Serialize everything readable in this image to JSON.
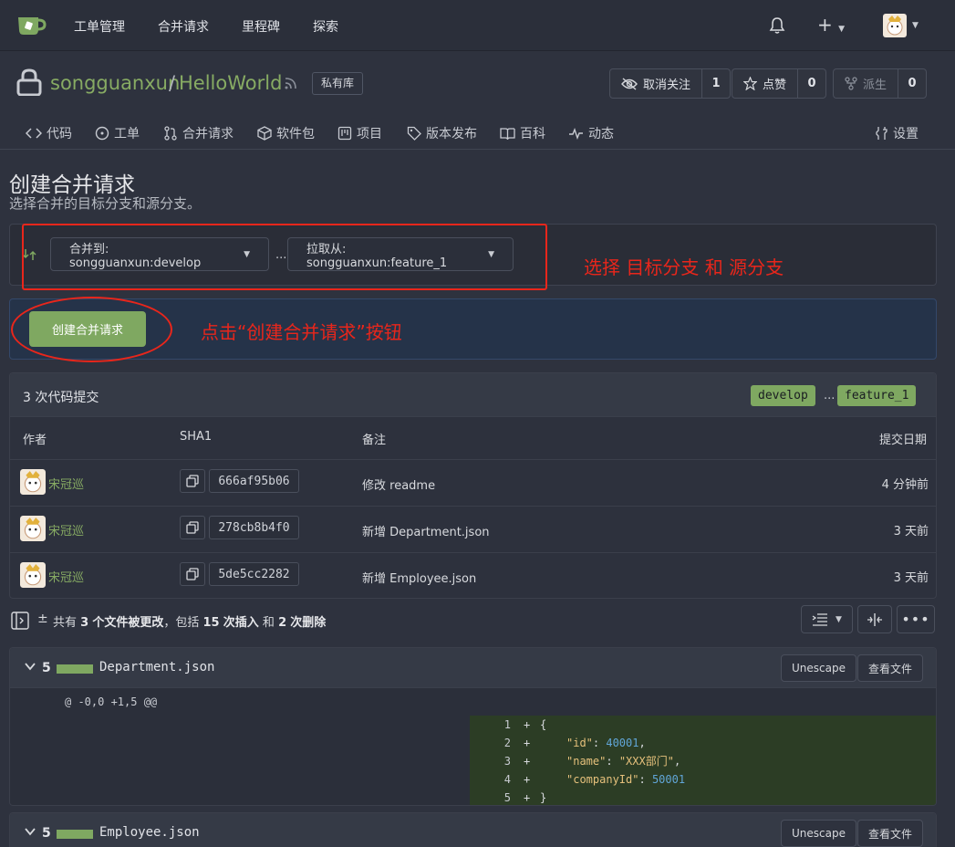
{
  "nav": {
    "items": [
      "工单管理",
      "合并请求",
      "里程碑",
      "探索"
    ]
  },
  "repo": {
    "owner": "songguanxun",
    "separator": "/",
    "name": "HelloWorld",
    "private_label": "私有库",
    "watch": {
      "label": "取消关注",
      "count": "1"
    },
    "star": {
      "label": "点赞",
      "count": "0"
    },
    "fork": {
      "label": "派生",
      "count": "0"
    }
  },
  "tabs": [
    {
      "label": "代码",
      "icon": "code-icon"
    },
    {
      "label": "工单",
      "icon": "issue-icon"
    },
    {
      "label": "合并请求",
      "icon": "pull-request-icon"
    },
    {
      "label": "软件包",
      "icon": "package-icon"
    },
    {
      "label": "项目",
      "icon": "project-icon"
    },
    {
      "label": "版本发布",
      "icon": "tag-icon"
    },
    {
      "label": "百科",
      "icon": "book-icon"
    },
    {
      "label": "动态",
      "icon": "pulse-icon"
    },
    {
      "label": "设置",
      "icon": "tools-icon"
    }
  ],
  "page": {
    "title": "创建合并请求",
    "subtitle": "选择合并的目标分支和源分支。",
    "target_branch": "合并到: songguanxun:develop",
    "dots": "...",
    "source_branch": "拉取从: songguanxun:feature_1",
    "create_button": "创建合并请求"
  },
  "annotations": {
    "branch_note": "选择 目标分支 和 源分支",
    "button_note": "点击“创建合并请求”按钮"
  },
  "commits": {
    "title": "3 次代码提交",
    "base": "develop",
    "dots": "...",
    "head": "feature_1",
    "headers": {
      "author": "作者",
      "sha": "SHA1",
      "message": "备注",
      "date": "提交日期"
    },
    "rows": [
      {
        "author": "宋冠巡",
        "sha": "666af95b06",
        "message": "修改 readme",
        "date": "4 分钟前"
      },
      {
        "author": "宋冠巡",
        "sha": "278cb8b4f0",
        "message": "新增 Department.json",
        "date": "3 天前"
      },
      {
        "author": "宋冠巡",
        "sha": "5de5cc2282",
        "message": "新增 Employee.json",
        "date": "3 天前"
      }
    ]
  },
  "diff_stats": {
    "prefix": "共有",
    "files": "3",
    "files_label": "个文件被更改",
    "mid": "，包括",
    "insertions": "15",
    "ins_label": "次插入",
    "and": "和",
    "deletions": "2",
    "del_label": "次删除"
  },
  "files": [
    {
      "count": "5",
      "name": "Department.json",
      "unescape": "Unescape",
      "view": "查看文件",
      "hunk": "@ -0,0 +1,5 @@",
      "lines": [
        {
          "n": "1",
          "sign": "+",
          "text": "{"
        },
        {
          "n": "2",
          "sign": "+",
          "key": "\"id\"",
          "value": "40001",
          "tail": ","
        },
        {
          "n": "3",
          "sign": "+",
          "key": "\"name\"",
          "value": "\"XXX部门\"",
          "tail": ","
        },
        {
          "n": "4",
          "sign": "+",
          "key": "\"companyId\"",
          "value": "50001",
          "tail": ""
        },
        {
          "n": "5",
          "sign": "+",
          "text": "}"
        }
      ]
    },
    {
      "count": "5",
      "name": "Employee.json",
      "unescape": "Unescape",
      "view": "查看文件"
    }
  ],
  "colors": {
    "accent": "#87ab63",
    "button": "#7fa861",
    "annotation": "#e9261b"
  }
}
